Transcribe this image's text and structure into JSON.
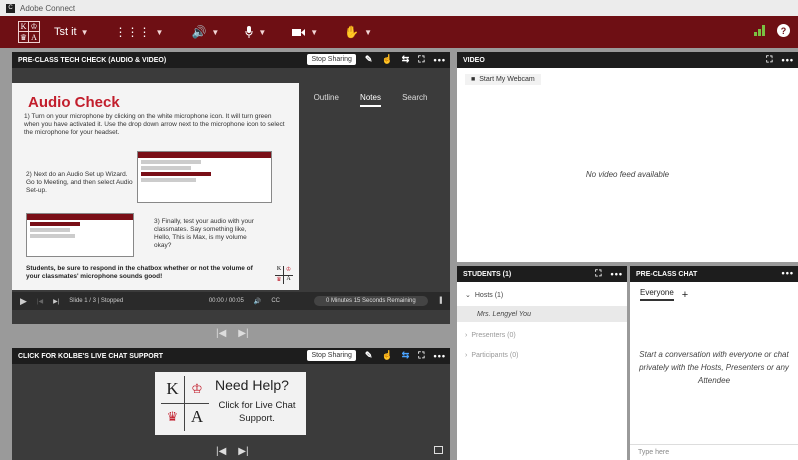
{
  "app": {
    "title": "Adobe Connect",
    "icon_label": "C"
  },
  "menubar": {
    "logo": [
      "K",
      "♔",
      "♛",
      "A"
    ],
    "meeting_name": "Tst it",
    "icons": [
      "apps-icon",
      "speaker-icon",
      "microphone-icon",
      "camera-icon",
      "raise-hand-icon"
    ],
    "help": "?"
  },
  "share_pod": {
    "title": "PRE-CLASS TECH CHECK (AUDIO & VIDEO)",
    "stop_sharing": "Stop Sharing",
    "tabs": [
      "Outline",
      "Notes",
      "Search"
    ],
    "active_tab": "Notes",
    "slide": {
      "title": "Audio Check",
      "step1": "1) Turn on your microphone by clicking on the white microphone icon. It will turn green when you have activated it. Use the drop down arrow next to the microphone icon to select the microphone for your headset.",
      "step2": "2) Next do an Audio Set up Wizard. Go to Meeting, and then select Audio Set-up.",
      "step3": "3) Finally, test your audio with your classmates. Say something like, Hello, This is Max, is my volume okay?",
      "footer": "Students, be sure to respond in the chatbox whether or not the volume of your classmates' microphone sounds good!",
      "logo": [
        "K",
        "♔",
        "♛",
        "A"
      ]
    },
    "controls": {
      "slide_info": "Slide 1 / 3 | Stopped",
      "time": "00:00 / 00:05",
      "cc": "CC",
      "remaining": "0 Minutes 15 Seconds Remaining"
    }
  },
  "live_chat_pod": {
    "title": "CLICK FOR KOLBE'S LIVE CHAT SUPPORT",
    "stop_sharing": "Stop Sharing",
    "help_big": "Need Help?",
    "help_small": "Click for Live Chat Support.",
    "logo": [
      "K",
      "♔",
      "♛",
      "A"
    ]
  },
  "video_pod": {
    "title": "VIDEO",
    "start_webcam": "Start My Webcam",
    "empty": "No video feed available"
  },
  "students_pod": {
    "title": "STUDENTS (1)",
    "hosts": "Hosts (1)",
    "host_name": "Mrs. Lengyel You",
    "presenters": "Presenters (0)",
    "participants": "Participants (0)"
  },
  "chat_pod": {
    "title": "PRE-CLASS CHAT",
    "tab": "Everyone",
    "add": "+",
    "empty": "Start a conversation with everyone or chat privately with the Hosts, Presenters or any Attendee",
    "placeholder": "Type here"
  }
}
